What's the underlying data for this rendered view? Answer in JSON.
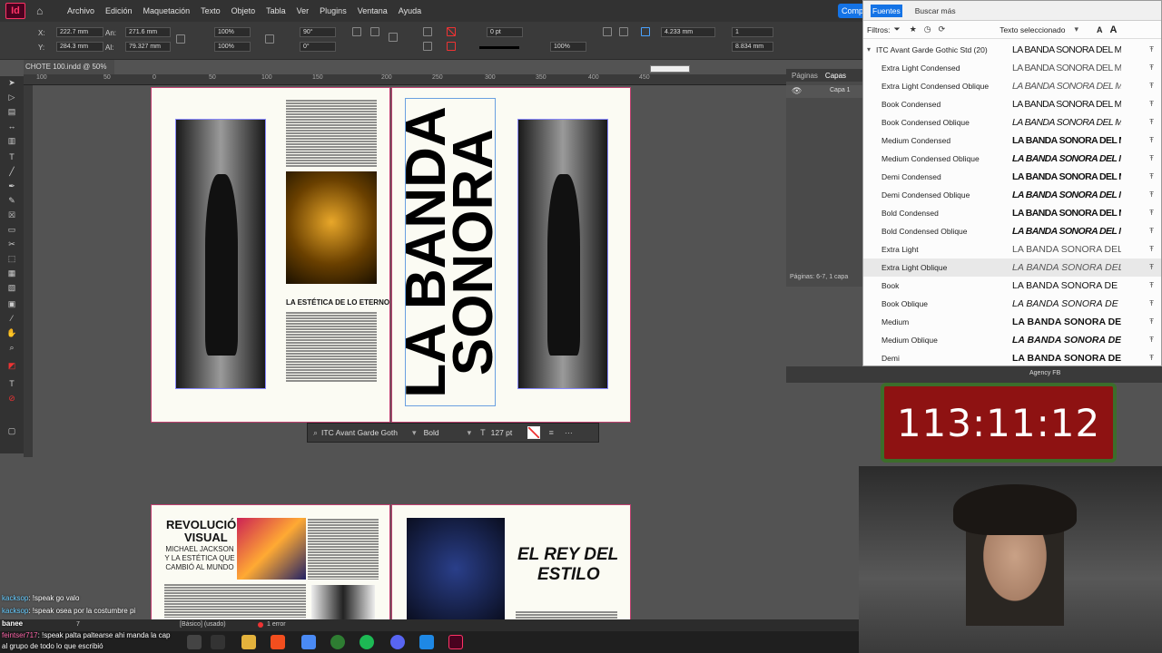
{
  "menubar": {
    "logo": "Id",
    "items": [
      "Archivo",
      "Edición",
      "Maquetación",
      "Texto",
      "Objeto",
      "Tabla",
      "Ver",
      "Plugins",
      "Ventana",
      "Ayuda"
    ],
    "comp_label": "Comp"
  },
  "controlbar": {
    "x_label": "X:",
    "x_value": "222.7 mm",
    "y_label": "Y:",
    "y_value": "284.3 mm",
    "w_label": "An:",
    "w_value": "271.6 mm",
    "h_label": "Al:",
    "h_value": "79.327 mm",
    "scale_x": "100%",
    "scale_y": "100%",
    "rotate": "90°",
    "shear": "0°",
    "stroke_weight": "0 pt",
    "opacity": "100%",
    "gap": "4.233 mm",
    "columns": "1",
    "gutter": "8.834 mm"
  },
  "document": {
    "tab_title": "CHOTE 100.indd @ 50%",
    "ruler_ticks": [
      "100",
      "50",
      "0",
      "50",
      "100",
      "150",
      "200",
      "250",
      "300",
      "350",
      "400",
      "450"
    ],
    "spread1": {
      "article_heading": "LA ESTÉTICA DE LO ETERNO",
      "vertical_title_line1": "LA BANDA",
      "vertical_title_line2": "SONORA"
    },
    "spread2": {
      "heading_line1": "REVOLUCIÓN",
      "heading_line2": "VISUAL",
      "subheading": "MICHAEL JACKSON Y LA ESTÉTICA QUE CAMBIÓ AL MUNDO",
      "right_heading_line1": "EL REY DEL",
      "right_heading_line2": "ESTILO"
    }
  },
  "floatbar": {
    "font": "ITC Avant Garde Goth",
    "style": "Bold",
    "size": "127 pt"
  },
  "panels": {
    "tab_pages": "Páginas",
    "tab_layers": "Capas",
    "layer_name": "Capa 1",
    "status": "Páginas: 6-7, 1 capa",
    "agency_font": "Agency FB"
  },
  "fontmenu": {
    "tab_fonts": "Fuentes",
    "tab_more": "Buscar más",
    "filter_label": "Filtros:",
    "preview_mode": "Texto seleccionado",
    "family": "ITC Avant Garde Gothic Std (20)",
    "family_sample": "LA BANDA SONORA DEL MUND",
    "fonts": [
      {
        "name": "Extra Light Condensed",
        "sample": "LA BANDA SONORA DEL MUND"
      },
      {
        "name": "Extra Light Condensed Oblique",
        "sample": "LA BANDA SONORA DEL MUND"
      },
      {
        "name": "Book Condensed",
        "sample": "LA BANDA SONORA DEL MUN"
      },
      {
        "name": "Book Condensed Oblique",
        "sample": "LA BANDA SONORA DEL MUN"
      },
      {
        "name": "Medium Condensed",
        "sample": "LA BANDA SONORA DEL MUN"
      },
      {
        "name": "Medium Condensed Oblique",
        "sample": "LA BANDA SONORA DEL MUI"
      },
      {
        "name": "Demi Condensed",
        "sample": "LA BANDA SONORA DEL MU"
      },
      {
        "name": "Demi Condensed Oblique",
        "sample": "LA BANDA SONORA DEL MU"
      },
      {
        "name": "Bold Condensed",
        "sample": "LA BANDA SONORA DEL MU"
      },
      {
        "name": "Bold Condensed Oblique",
        "sample": "LA BANDA SONORA DEL MI"
      },
      {
        "name": "Extra Light",
        "sample": "LA BANDA SONORA DEL"
      },
      {
        "name": "Extra Light Oblique",
        "sample": "LA BANDA SONORA DEL"
      },
      {
        "name": "Book",
        "sample": "LA BANDA SONORA DE"
      },
      {
        "name": "Book Oblique",
        "sample": "LA BANDA SONORA DE"
      },
      {
        "name": "Medium",
        "sample": "LA BANDA SONORA DEI"
      },
      {
        "name": "Medium Oblique",
        "sample": "LA BANDA SONORA DEI"
      },
      {
        "name": "Demi",
        "sample": "LA BANDA SONORA DE"
      }
    ],
    "similar_icon_text": "≈"
  },
  "timer": {
    "value": "113:11:12"
  },
  "chat": [
    {
      "user": "kacksop",
      "text": ": !speak go valo"
    },
    {
      "user": "kacksop",
      "text": ": !speak osea por la costumbre pi"
    },
    {
      "user": "banee",
      "text": ""
    },
    {
      "user": "feintser717",
      "text": ": !speak palta paltearse ahi manda la cap"
    },
    {
      "user": "",
      "text": "al grupo de todo lo que escribió"
    }
  ],
  "statusbar": {
    "page": "7",
    "preflight_profile": "[Básico] (usado)",
    "errors": "1 error"
  },
  "colors": {
    "accent": "#1473e6",
    "indesign": "#ff3366",
    "timer_bg": "#8e1212",
    "timer_border": "#3c6d2b"
  }
}
